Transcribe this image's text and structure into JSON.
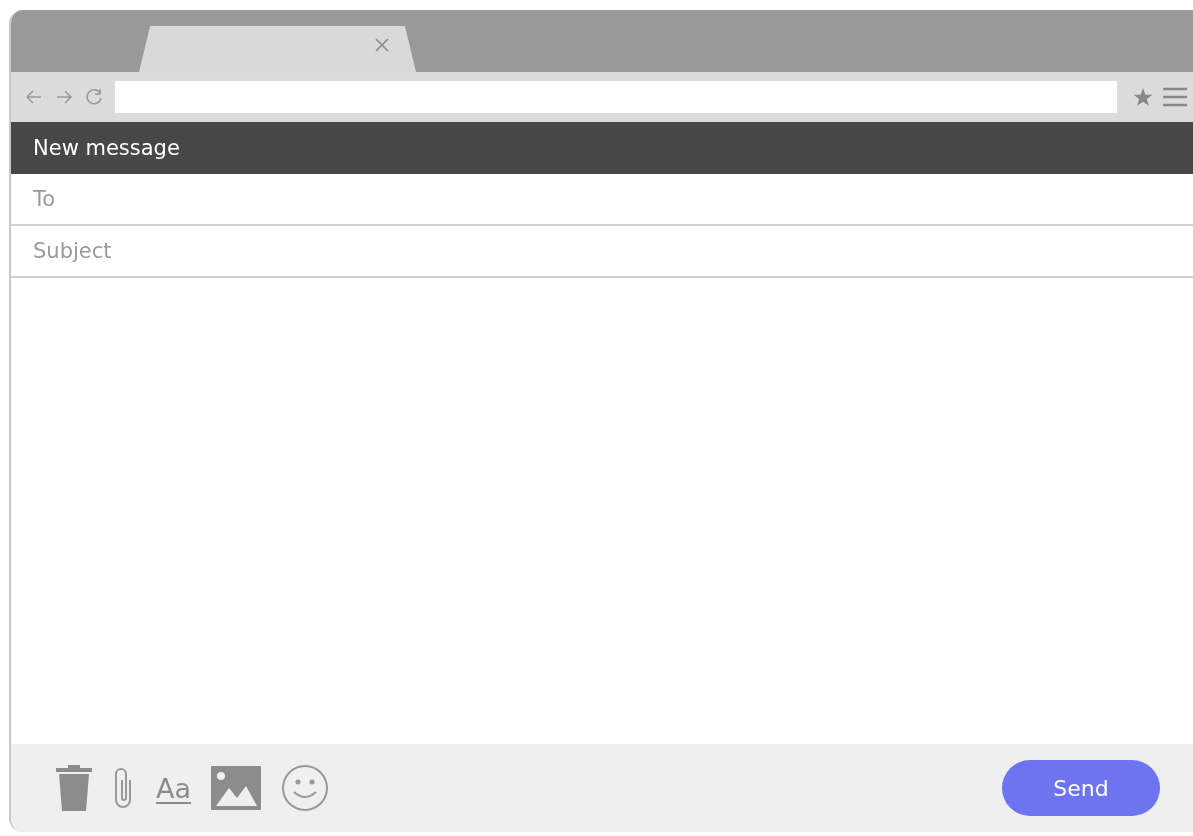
{
  "window": {
    "title": "New message"
  },
  "fields": [
    {
      "placeholder": "To"
    },
    {
      "placeholder": "Subject"
    }
  ],
  "toolbar": {
    "format_label": "Aa"
  },
  "send_button": {
    "label": "Send"
  }
}
